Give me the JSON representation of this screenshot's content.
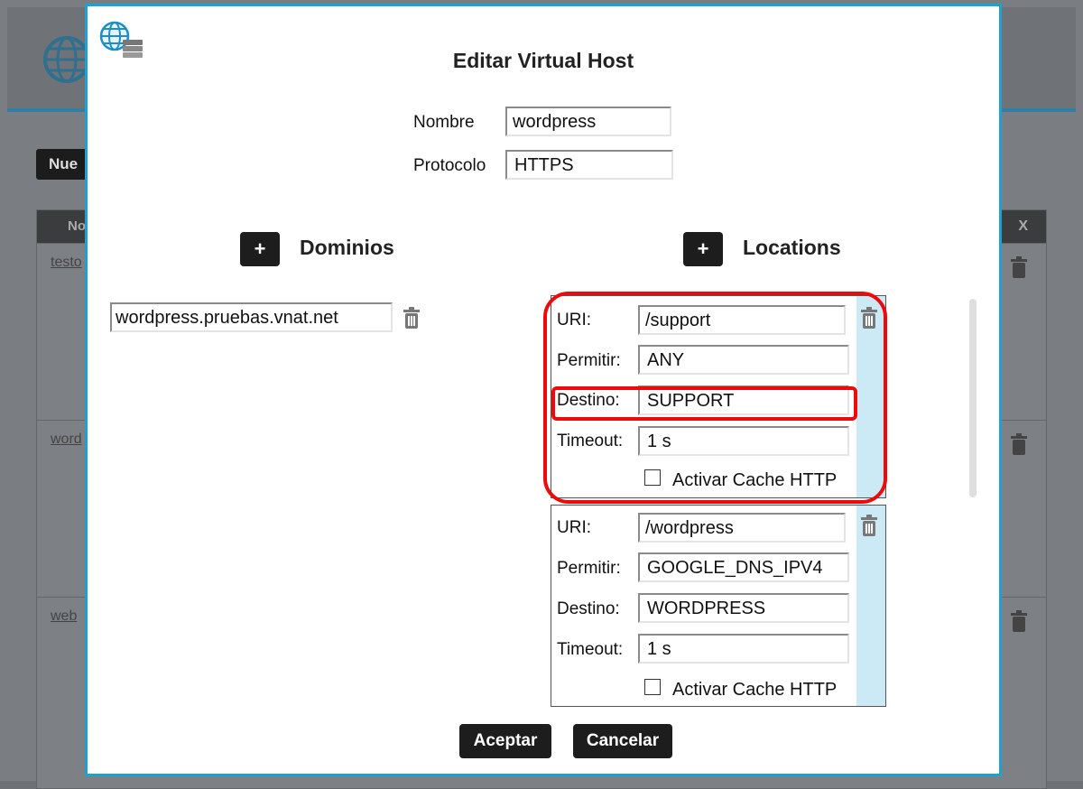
{
  "background": {
    "new_button_label": "Nue",
    "table_header_first": "No",
    "table_header_x": "X",
    "rows": [
      {
        "link": "testo"
      },
      {
        "link": "word"
      },
      {
        "link": "web"
      }
    ]
  },
  "modal": {
    "title": "Editar Virtual Host",
    "name_label": "Nombre",
    "name_value": "wordpress",
    "protocol_label": "Protocolo",
    "protocol_value": "HTTPS",
    "domains": {
      "title": "Dominios",
      "add_label": "+",
      "items": [
        {
          "value": "wordpress.pruebas.vnat.net"
        }
      ]
    },
    "locations": {
      "title": "Locations",
      "add_label": "+",
      "field_labels": {
        "uri": "URI:",
        "permitir": "Permitir:",
        "destino": "Destino:",
        "timeout": "Timeout:",
        "cache": "Activar Cache HTTP"
      },
      "items": [
        {
          "uri": "/support",
          "permitir": "ANY",
          "destino": "SUPPORT",
          "timeout": "1 s",
          "cache_checked": false
        },
        {
          "uri": "/wordpress",
          "permitir": "GOOGLE_DNS_IPV4",
          "destino": "WORDPRESS",
          "timeout": "1 s",
          "cache_checked": false
        }
      ]
    },
    "accept_label": "Aceptar",
    "cancel_label": "Cancelar"
  },
  "colors": {
    "modal_border": "#1fa0d2",
    "highlight": "#ee0a0a",
    "location_side": "#cce9f6",
    "button_bg": "#1d1d1d"
  }
}
